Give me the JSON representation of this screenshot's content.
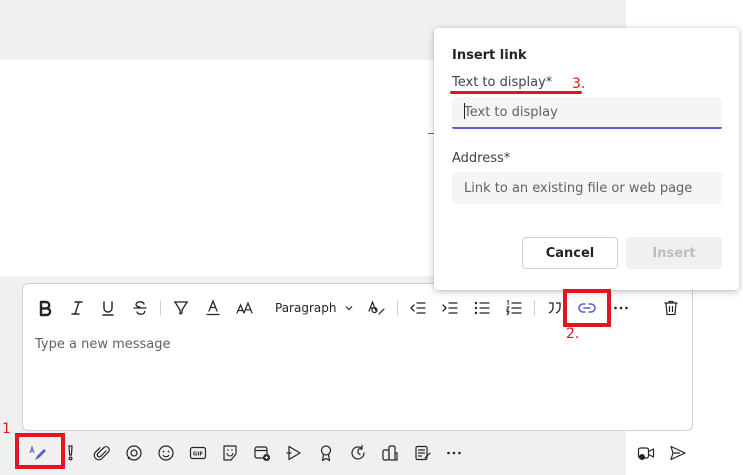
{
  "dialog": {
    "title": "Insert link",
    "text_label": "Text to display*",
    "text_placeholder": "Text to display",
    "address_label": "Address*",
    "address_placeholder": "Link to an existing file or web page",
    "cancel_label": "Cancel",
    "insert_label": "Insert"
  },
  "compose": {
    "paragraph_label": "Paragraph",
    "message_placeholder": "Type a new message"
  },
  "annotations": {
    "step1": "1",
    "step2": "2.",
    "step3": "3."
  },
  "colors": {
    "accent": "#5b5fc7",
    "annotation": "#e3161f"
  },
  "icons": {
    "format_toolbar": [
      "bold-icon",
      "italic-icon",
      "underline-icon",
      "strikethrough-icon",
      "highlight-icon",
      "font-color-icon",
      "font-size-icon",
      "paragraph-chevron-icon",
      "clear-format-icon",
      "decrease-indent-icon",
      "increase-indent-icon",
      "bulleted-list-icon",
      "numbered-list-icon",
      "quote-icon",
      "link-icon",
      "more-options-icon",
      "delete-icon"
    ],
    "bottom_toolbar": [
      "format-icon",
      "priority-icon",
      "attach-icon",
      "loop-icon",
      "emoji-icon",
      "gif-icon",
      "sticker-icon",
      "schedule-meeting-icon",
      "stream-icon",
      "praise-icon",
      "updates-icon",
      "apps-icon",
      "approvals-icon",
      "more-icon",
      "video-clip-icon",
      "send-icon"
    ]
  }
}
